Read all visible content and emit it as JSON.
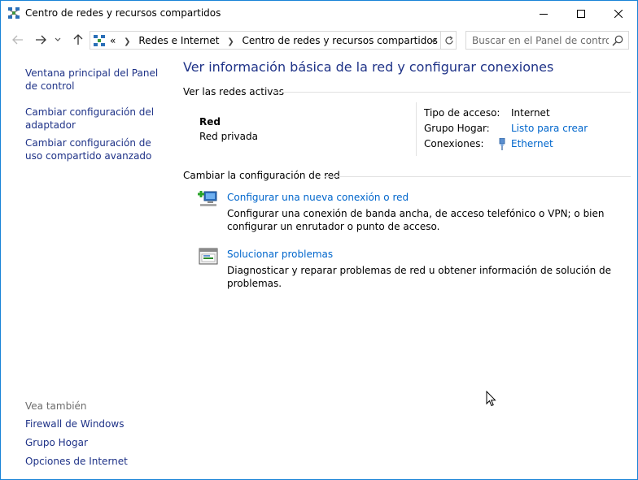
{
  "window": {
    "title": "Centro de redes y recursos compartidos"
  },
  "address": {
    "crumbs": [
      "Redes e Internet",
      "Centro de redes y recursos compartidos"
    ],
    "overflow": "«"
  },
  "search": {
    "placeholder": "Buscar en el Panel de control"
  },
  "sidebar": {
    "links": [
      "Ventana principal del Panel de control",
      "Cambiar configuración del adaptador",
      "Cambiar configuración de uso compartido avanzado"
    ],
    "see_also_title": "Vea también",
    "see_also": [
      "Firewall de Windows",
      "Grupo Hogar",
      "Opciones de Internet"
    ]
  },
  "main": {
    "heading": "Ver información básica de la red y configurar conexiones",
    "active_networks_title": "Ver las redes activas",
    "network": {
      "name": "Red",
      "type": "Red privada",
      "access_type_label": "Tipo de acceso:",
      "access_type_value": "Internet",
      "homegroup_label": "Grupo Hogar:",
      "homegroup_value": "Listo para crear",
      "connections_label": "Conexiones:",
      "connections_value": "Ethernet"
    },
    "change_settings_title": "Cambiar la configuración de red",
    "tasks": [
      {
        "title": "Configurar una nueva conexión o red",
        "description": "Configurar una conexión de banda ancha, de acceso telefónico o VPN; o bien configurar un enrutador o punto de acceso."
      },
      {
        "title": "Solucionar problemas",
        "description": "Diagnosticar y reparar problemas de red u obtener información de solución de problemas."
      }
    ]
  },
  "colors": {
    "link": "#0066cc",
    "sidebar_link": "#1e3287",
    "heading": "#1e3287",
    "window_border": "#1883d7"
  }
}
